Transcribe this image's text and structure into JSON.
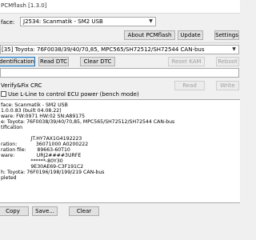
{
  "window": {
    "title": "PCMflash [1.3.0]"
  },
  "interface": {
    "label": "face:",
    "selected": "J2534: Scanmatik - SM2 USB"
  },
  "toolbar": {
    "about": "About PCMflash",
    "update": "Update",
    "settings": "Settings"
  },
  "module": {
    "selected": "[35] Toyota: 76F0038/39/40/70,85, MPC565/SH72512/SH72544 CAN-bus"
  },
  "actions": {
    "identification": "Identification",
    "read_dtc": "Read DTC",
    "clear_dtc": "Clear DTC",
    "reset_kam": "Reset KAM",
    "reboot": "Reboot"
  },
  "verify": {
    "label": "Verify&Fix CRC",
    "read": "Read",
    "write": "Write"
  },
  "kline": {
    "label": "Use L-Line to control ECU power (bench mode)"
  },
  "log": [
    "face: Scanmatik - SM2 USB",
    "1.0.0.83 (built 04.08.22)",
    "ware: FW:0971 HW:02 SN:A89175",
    "e: Toyota: 76F0038/39/40/70,85, MPC565/SH72512/SH72544 CAN-bus",
    "tification",
    "",
    "                   JT.HY7AX1G4192223",
    "ration:            36071000 A0200222",
    "ration file:       89663-60T10",
    "ware:              URJ2####3URFE",
    "                   ******-80Y30",
    "                   9E30AE69-C3F191C2",
    "h: Toyota: 76F0196/198/199/219 CAN-bus",
    "pleted"
  ],
  "bottom": {
    "copy": "Copy",
    "save": "Save...",
    "clear": "Clear"
  }
}
